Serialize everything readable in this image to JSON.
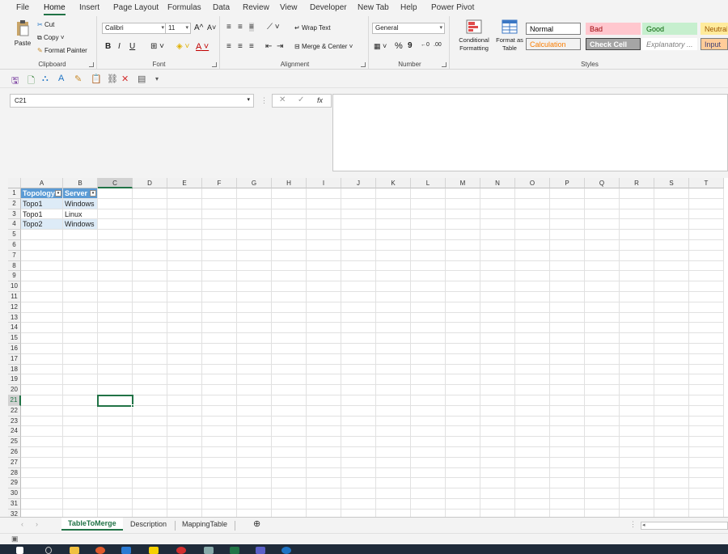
{
  "menu": [
    "File",
    "Home",
    "Insert",
    "Page Layout",
    "Formulas",
    "Data",
    "Review",
    "View",
    "Developer",
    "New Tab",
    "Help",
    "Power Pivot"
  ],
  "clipboard": {
    "paste": "Paste",
    "cut": "Cut",
    "copy": "Copy",
    "format_painter": "Format Painter",
    "label": "Clipboard"
  },
  "font": {
    "name": "Calibri",
    "size": "11",
    "label": "Font",
    "bold": "B",
    "italic": "I",
    "underline": "U",
    "grow": "A^",
    "shrink": "A˅"
  },
  "alignment": {
    "wrap": "Wrap Text",
    "merge": "Merge & Center",
    "label": "Alignment"
  },
  "number": {
    "format": "General",
    "percent": "%",
    "comma": "9",
    "label": "Number"
  },
  "styles": {
    "conditional": "Conditional Formatting",
    "format_table": "Format as Table",
    "label": "Styles",
    "gallery": [
      {
        "text": "Normal",
        "bg": "#ffffff",
        "fg": "#000000",
        "border": "#7f7f7f"
      },
      {
        "text": "Bad",
        "bg": "#ffc7ce",
        "fg": "#9c0006",
        "border": "#ffc7ce"
      },
      {
        "text": "Good",
        "bg": "#c6efce",
        "fg": "#006100",
        "border": "#c6efce"
      },
      {
        "text": "Neutral",
        "bg": "#ffeb9c",
        "fg": "#9c5700",
        "border": "#ffeb9c"
      },
      {
        "text": "Calculation",
        "bg": "#f2f2f2",
        "fg": "#fa7d00",
        "border": "#7f7f7f"
      },
      {
        "text": "Check Cell",
        "bg": "#a5a5a5",
        "fg": "#ffffff",
        "border": "#3f3f3f"
      },
      {
        "text": "Explanatory ...",
        "bg": "#ffffff",
        "fg": "#7f7f7f",
        "border": "#ffffff"
      },
      {
        "text": "Input",
        "bg": "#ffcc99",
        "fg": "#3f3f76",
        "border": "#7f7f7f"
      }
    ]
  },
  "namebox": "C21",
  "fx": "fx",
  "columns": [
    "A",
    "B",
    "C",
    "D",
    "E",
    "F",
    "G",
    "H",
    "I",
    "J",
    "K",
    "L",
    "M",
    "N",
    "O",
    "P",
    "Q",
    "R",
    "S",
    "T"
  ],
  "rows": [
    "1",
    "2",
    "3",
    "4",
    "5",
    "6",
    "7",
    "8",
    "9",
    "10",
    "11",
    "12",
    "13",
    "14",
    "15",
    "16",
    "17",
    "18",
    "19",
    "20",
    "21",
    "22",
    "23",
    "24",
    "25",
    "26",
    "27",
    "28",
    "29",
    "30",
    "31",
    "32"
  ],
  "table": {
    "headers": [
      "Topology",
      "Server"
    ],
    "rows": [
      [
        "Topo1",
        "Windows"
      ],
      [
        "Topo1",
        "Linux"
      ],
      [
        "Topo2",
        "Windows"
      ]
    ]
  },
  "sheets": [
    "TableToMerge",
    "Description",
    "MappingTable"
  ],
  "active_sheet": "TableToMerge",
  "colors": {
    "accent": "#217346",
    "table_header": "#5b9bd5",
    "table_band": "#ddebf7"
  }
}
